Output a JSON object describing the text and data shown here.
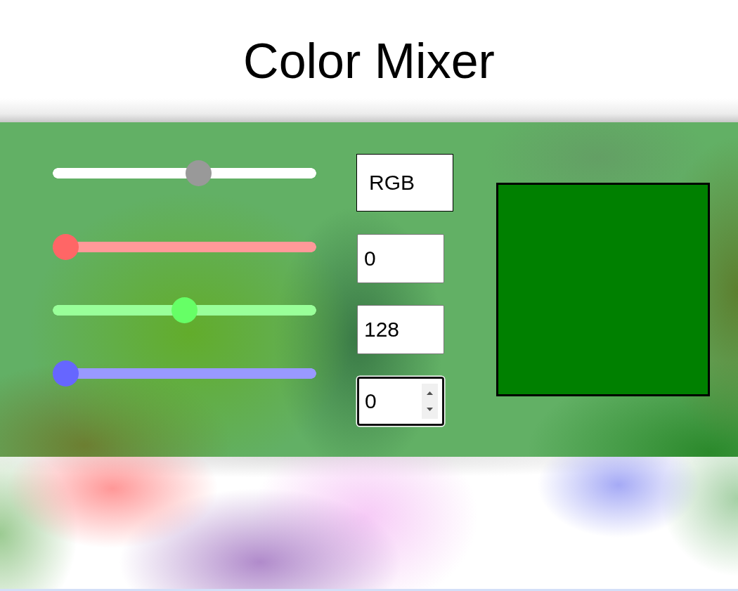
{
  "title": "Color Mixer",
  "sliders": [
    {
      "track": {
        "color": "#ffffff"
      },
      "thumb": {
        "color": "#999999"
      },
      "level": 0.56
    },
    {
      "track": {
        "color": "#ff9999"
      },
      "thumb": {
        "color": "#ff6666"
      },
      "level": 0
    },
    {
      "track": {
        "color": "#99ff99"
      },
      "thumb": {
        "color": "#66ff66"
      },
      "level": 0.5
    },
    {
      "track": {
        "color": "#9999ff"
      },
      "thumb": {
        "color": "#6666ff"
      },
      "level": 0
    }
  ],
  "fields": [
    {
      "kind": "text",
      "value": "RGB",
      "focused": false
    },
    {
      "kind": "number",
      "value": "0",
      "focused": false
    },
    {
      "kind": "number",
      "value": "128",
      "focused": false
    },
    {
      "kind": "number",
      "value": "0",
      "focused": true
    }
  ],
  "preview": {
    "color": "#008000"
  }
}
